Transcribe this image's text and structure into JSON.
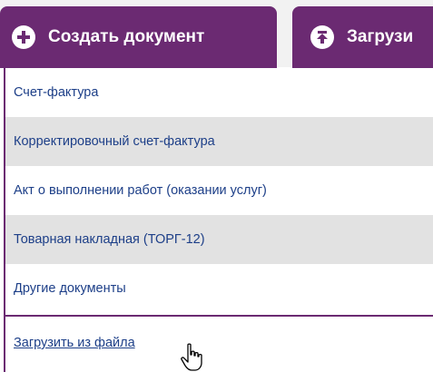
{
  "tabs": [
    {
      "label": "Создать документ",
      "icon": "plus-circle-icon"
    },
    {
      "label": "Загрузи",
      "icon": "upload-circle-icon"
    }
  ],
  "menu": {
    "items": [
      {
        "label": "Счет-фактура"
      },
      {
        "label": "Корректировочный счет-фактура"
      },
      {
        "label": "Акт о выполнении работ (оказании услуг)"
      },
      {
        "label": "Товарная накладная (ТОРГ-12)"
      },
      {
        "label": "Другие документы"
      }
    ],
    "upload_link": "Загрузить из файла"
  },
  "colors": {
    "accent": "#6b2a72",
    "link": "#1d3f88",
    "alt_row": "#e2e2e2"
  }
}
